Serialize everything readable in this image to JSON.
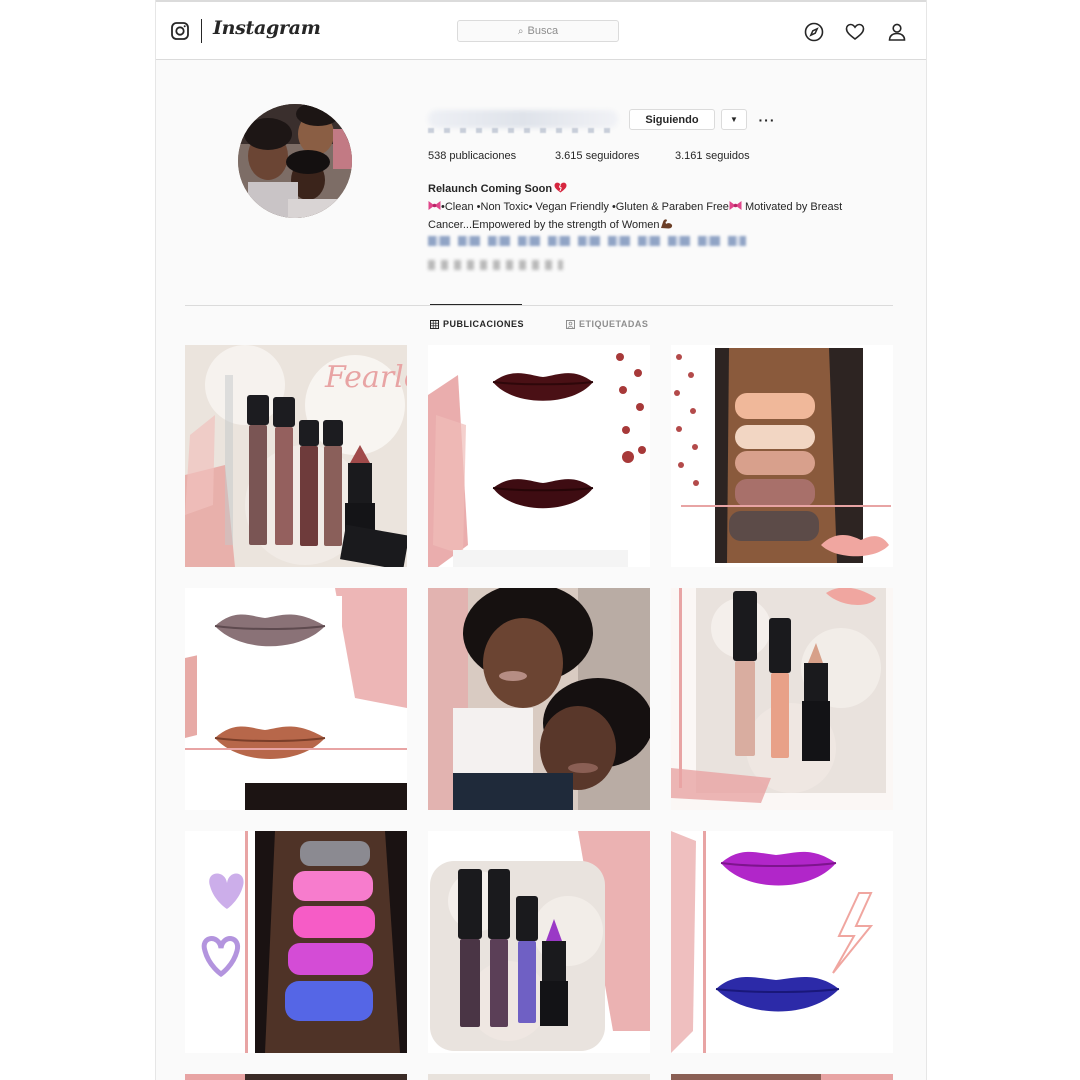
{
  "nav": {
    "brand": "Instagram",
    "search_placeholder": "Busca"
  },
  "profile": {
    "follow_label": "Siguiendo",
    "stats": {
      "posts": "538 publicaciones",
      "followers": "3.615 seguidores",
      "following": "3.161 seguidos"
    },
    "bio": {
      "name": "Relaunch Coming Soon",
      "line1": "•Clean •Non Toxic• Vegan Friendly •Gluten & Paraben Free",
      "line1_tail": " Motivated by Breast",
      "line2": "Cancer...Empowered by the strength of Women"
    }
  },
  "tabs": {
    "posts": "PUBLICACIONES",
    "tagged": "ETIQUETADAS"
  },
  "posts": {
    "p1_text": "Fearless"
  },
  "colors": {
    "text": "#262626",
    "muted": "#8e8e8e",
    "border": "#dbdbdb",
    "pink_accent": "#e8a4a4"
  }
}
